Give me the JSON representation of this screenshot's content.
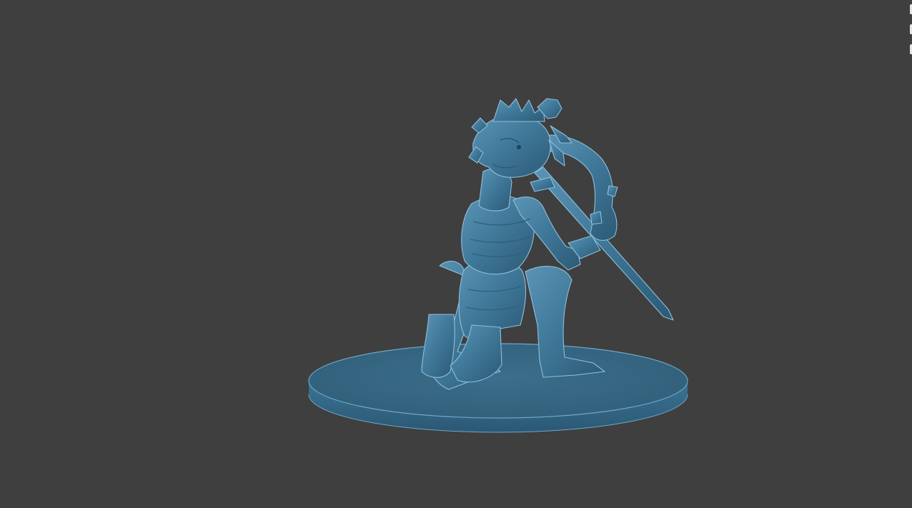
{
  "viewport": {
    "background_color": "#3f3f3f",
    "model": {
      "name": "miniature-figure",
      "description_icon": "kneeling-insect-warrior-with-spear",
      "material_color": "#3f7798",
      "shadow_color": "#2c5a75",
      "highlight_color": "#7db3d1",
      "rim_color": "#9cc8e0"
    },
    "base": {
      "shape": "oval",
      "top_color": "#3a6f8d",
      "side_color": "#2e5d78"
    },
    "edge_marks_color": "#e6e6e6"
  }
}
